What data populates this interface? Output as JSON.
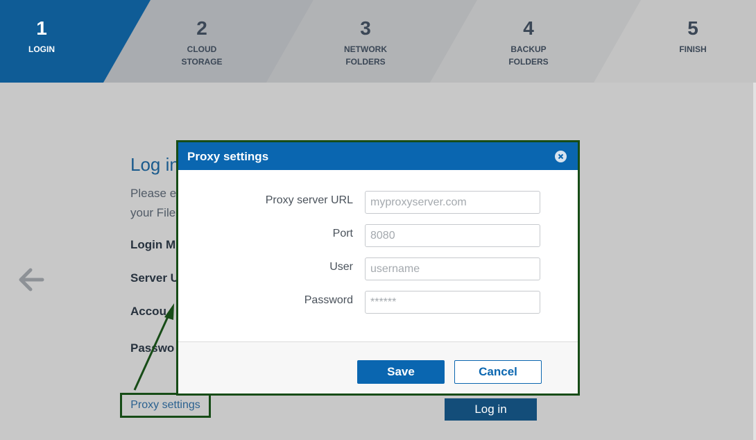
{
  "stepper": {
    "steps": [
      {
        "number": "1",
        "label": "LOGIN"
      },
      {
        "number": "2",
        "label": "CLOUD\nSTORAGE"
      },
      {
        "number": "3",
        "label": "NETWORK\nFOLDERS"
      },
      {
        "number": "4",
        "label": "BACKUP\nFOLDERS"
      },
      {
        "number": "5",
        "label": "FINISH"
      }
    ]
  },
  "login": {
    "title": "Log in",
    "desc_line1": "Please e",
    "desc_line2": "your File",
    "labels": [
      "Login M",
      "Server U",
      "Accou",
      "Passwo"
    ],
    "proxy_link": "Proxy settings",
    "login_button": "Log in"
  },
  "dialog": {
    "title": "Proxy settings",
    "fields": [
      {
        "label": "Proxy server URL",
        "placeholder": "myproxyserver.com"
      },
      {
        "label": "Port",
        "placeholder": "8080"
      },
      {
        "label": "User",
        "placeholder": "username"
      },
      {
        "label": "Password",
        "placeholder": "******"
      }
    ],
    "save_label": "Save",
    "cancel_label": "Cancel"
  },
  "colors": {
    "accent": "#0a66b0",
    "stepper_active": "#0f5c96",
    "highlight_border": "#174c17"
  }
}
